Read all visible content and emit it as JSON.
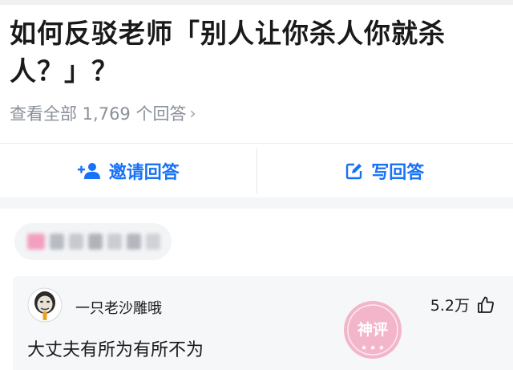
{
  "question": {
    "title": "如何反驳老师「别人让你杀人你就杀人？」？"
  },
  "answers_link": {
    "label": "查看全部 1,769 个回答",
    "chevron": "›"
  },
  "actions": {
    "invite_label": "邀请回答",
    "write_label": "写回答",
    "accent_color": "#1772f6"
  },
  "comment": {
    "username": "一只老沙雕哦",
    "likes": "5.2万",
    "text": "大丈夫有所为有所不为",
    "stamp_text": "神评"
  }
}
